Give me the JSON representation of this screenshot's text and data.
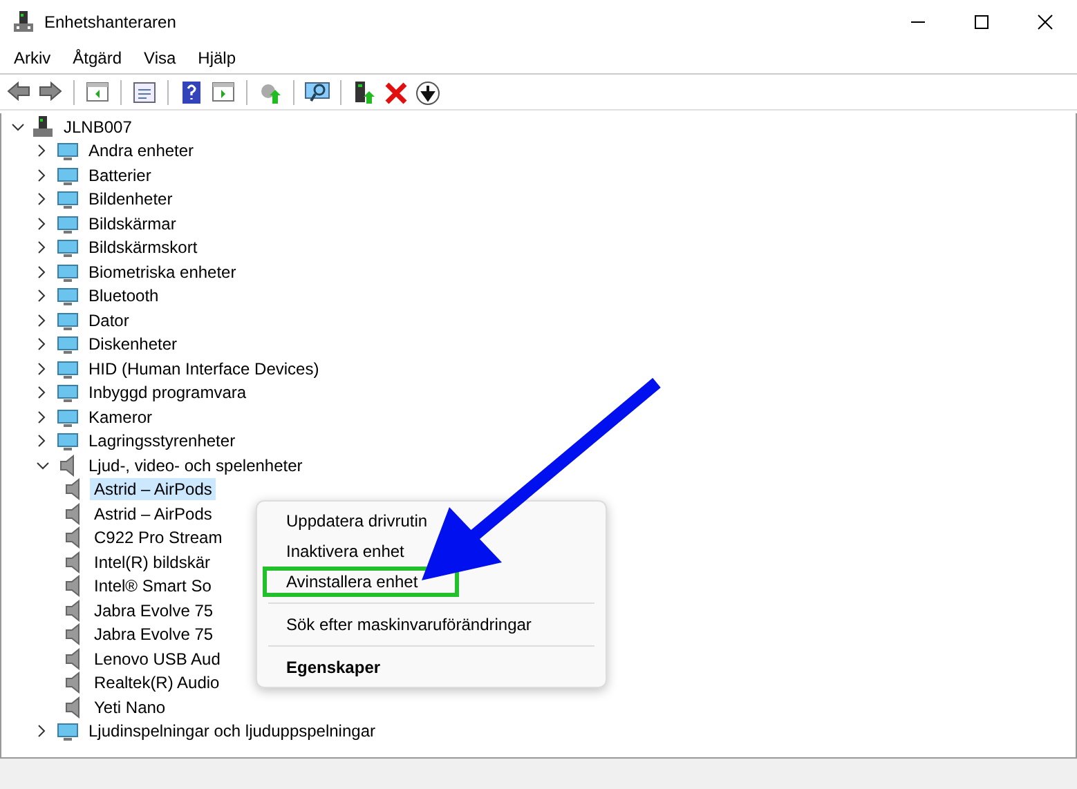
{
  "window": {
    "title": "Enhetshanteraren"
  },
  "menu_bar": [
    "Arkiv",
    "Åtgärd",
    "Visa",
    "Hjälp"
  ],
  "toolbar": [
    {
      "kind": "back"
    },
    {
      "kind": "forward"
    },
    {
      "kind": "sep"
    },
    {
      "kind": "pane"
    },
    {
      "kind": "sep"
    },
    {
      "kind": "properties"
    },
    {
      "kind": "sep"
    },
    {
      "kind": "help"
    },
    {
      "kind": "pane-play"
    },
    {
      "kind": "sep"
    },
    {
      "kind": "update"
    },
    {
      "kind": "sep"
    },
    {
      "kind": "scan"
    },
    {
      "kind": "sep"
    },
    {
      "kind": "add-device"
    },
    {
      "kind": "remove"
    },
    {
      "kind": "download"
    }
  ],
  "tree": {
    "label": "JLNB007",
    "expanded": true,
    "children": [
      {
        "label": "Andra enheter",
        "expanded": false
      },
      {
        "label": "Batterier",
        "expanded": false
      },
      {
        "label": "Bildenheter",
        "expanded": false
      },
      {
        "label": "Bildskärmar",
        "expanded": false
      },
      {
        "label": "Bildskärmskort",
        "expanded": false
      },
      {
        "label": "Biometriska enheter",
        "expanded": false
      },
      {
        "label": "Bluetooth",
        "expanded": false
      },
      {
        "label": "Dator",
        "expanded": false
      },
      {
        "label": "Diskenheter",
        "expanded": false
      },
      {
        "label": "HID (Human Interface Devices)",
        "expanded": false
      },
      {
        "label": "Inbyggd programvara",
        "expanded": false
      },
      {
        "label": "Kameror",
        "expanded": false
      },
      {
        "label": "Lagringsstyrenheter",
        "expanded": false
      },
      {
        "label": "Ljud-, video- och spelenheter",
        "expanded": true,
        "children": [
          {
            "label": "Astrid  – AirPods",
            "selected": true
          },
          {
            "label": "Astrid  – AirPods",
            "selected": false
          },
          {
            "label": "C922 Pro Stream",
            "selected": false
          },
          {
            "label": "Intel(R) bildskär",
            "selected": false
          },
          {
            "label": "Intel® Smart So",
            "selected": false
          },
          {
            "label": "Jabra Evolve 75",
            "selected": false
          },
          {
            "label": "Jabra Evolve 75",
            "selected": false
          },
          {
            "label": "Lenovo USB Aud",
            "selected": false
          },
          {
            "label": "Realtek(R) Audio",
            "selected": false
          },
          {
            "label": "Yeti Nano",
            "selected": false
          }
        ]
      },
      {
        "label": "Ljudinspelningar och ljuduppspelningar",
        "expanded": false
      }
    ]
  },
  "context_menu": [
    {
      "kind": "item",
      "label": "Uppdatera drivrutin",
      "highlighted": false
    },
    {
      "kind": "item",
      "label": "Inaktivera enhet",
      "highlighted": false
    },
    {
      "kind": "item",
      "label": "Avinstallera enhet",
      "highlighted": true
    },
    {
      "kind": "sep"
    },
    {
      "kind": "item",
      "label": "Sök efter maskinvaruförändringar",
      "highlighted": false
    },
    {
      "kind": "sep"
    },
    {
      "kind": "bold",
      "label": "Egenskaper",
      "highlighted": false
    }
  ]
}
